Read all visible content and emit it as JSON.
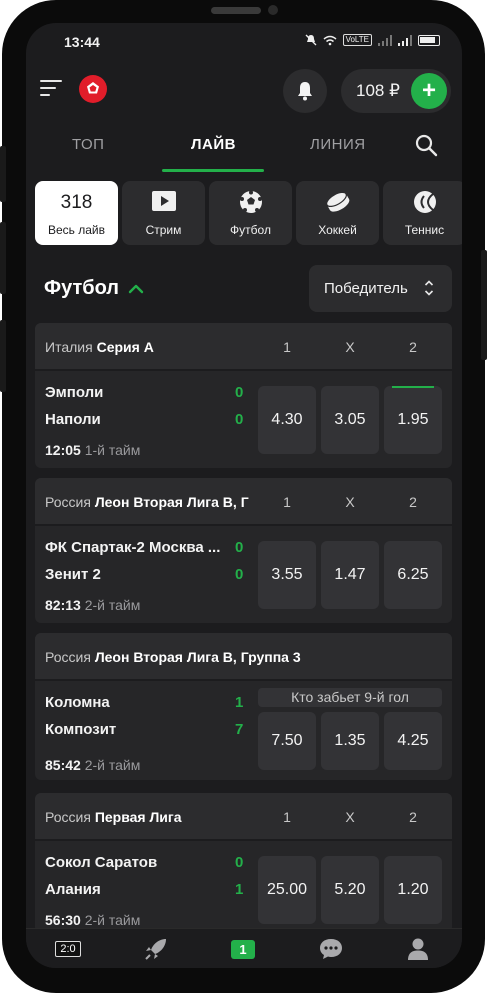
{
  "status": {
    "time": "13:44",
    "volte": "VoLTE"
  },
  "header": {
    "balance": "108 ₽",
    "add_label": "+"
  },
  "tabs": [
    {
      "label": "ТОП"
    },
    {
      "label": "ЛАЙВ"
    },
    {
      "label": "ЛИНИЯ"
    }
  ],
  "sports": [
    {
      "count": "318",
      "label": "Весь лайв",
      "icon": "live-count"
    },
    {
      "label": "Стрим",
      "icon": "play-icon"
    },
    {
      "label": "Футбол",
      "icon": "soccer-ball-icon"
    },
    {
      "label": "Хоккей",
      "icon": "hockey-puck-icon"
    },
    {
      "label": "Теннис",
      "icon": "tennis-ball-icon"
    }
  ],
  "section": {
    "title": "Футбол",
    "market": "Победитель"
  },
  "cols": {
    "c1": "1",
    "cx": "X",
    "c2": "2"
  },
  "matches": [
    {
      "country": "Италия",
      "league": "Серия А",
      "home": "Эмполи",
      "away": "Наполи",
      "home_score": "0",
      "away_score": "0",
      "time": "12:05",
      "period": "1-й тайм",
      "odds": [
        "4.30",
        "3.05",
        "1.95"
      ]
    },
    {
      "country": "Россия",
      "league": "Леон Вторая Лига B, Г",
      "home": "ФК Спартак-2 Москва ...",
      "away": "Зенит 2",
      "home_score": "0",
      "away_score": "0",
      "time": "82:13",
      "period": "2-й тайм",
      "odds": [
        "3.55",
        "1.47",
        "6.25"
      ]
    },
    {
      "country": "Россия",
      "league": "Леон Вторая Лига B, Группа 3",
      "home": "Коломна",
      "away": "Композит",
      "home_score": "1",
      "away_score": "7",
      "time": "85:42",
      "period": "2-й тайм",
      "submarket": "Кто забьет 9-й гол",
      "odds": [
        "7.50",
        "1.35",
        "4.25"
      ]
    },
    {
      "country": "Россия",
      "league": "Первая Лига",
      "home": "Сокол Саратов",
      "away": "Алания",
      "home_score": "0",
      "away_score": "1",
      "time": "56:30",
      "period": "2-й тайм",
      "odds": [
        "25.00",
        "5.20",
        "1.20"
      ]
    }
  ],
  "bottom_nav": {
    "score": "2:0",
    "count": "1"
  },
  "colors": {
    "accent": "#23b04a",
    "bg": "#1c1c1e",
    "card": "#2c2c2e"
  }
}
